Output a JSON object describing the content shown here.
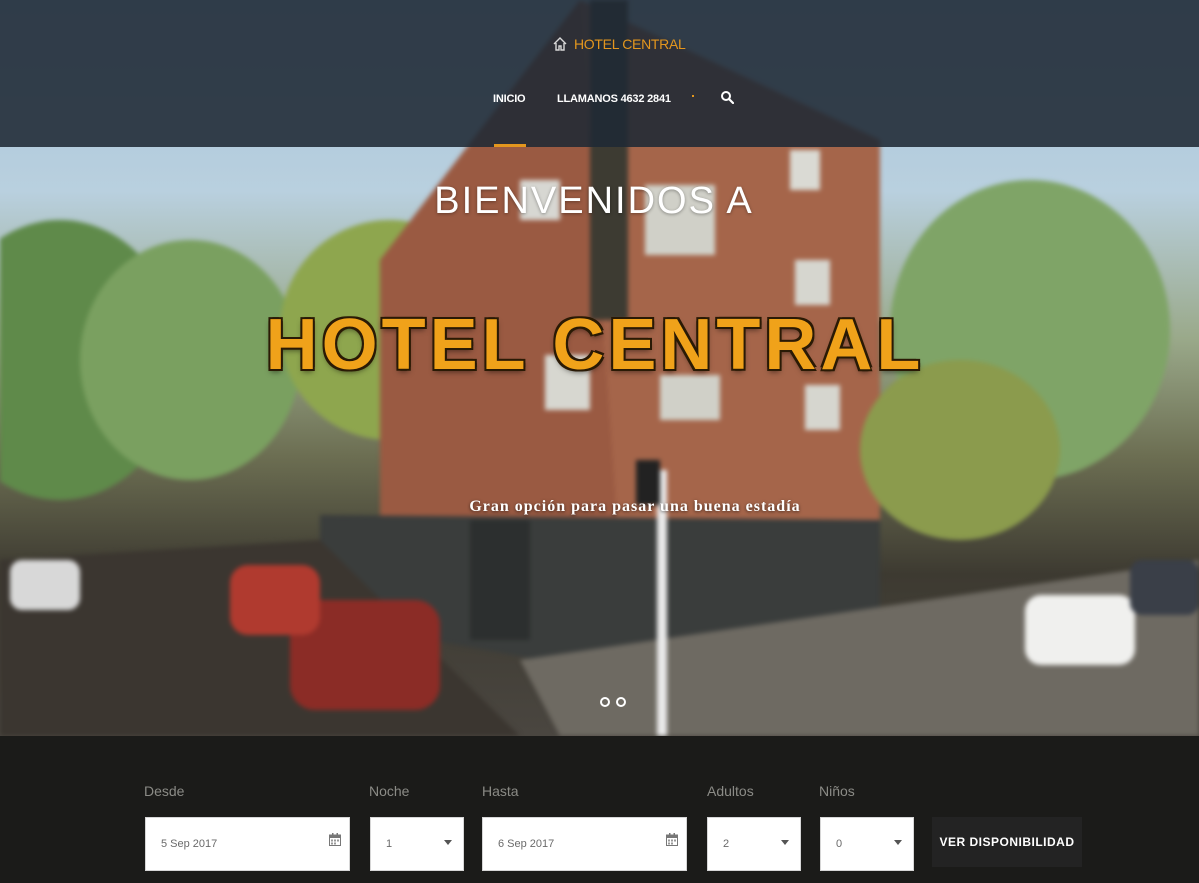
{
  "header": {
    "logo_text": "HOTEL CENTRAL",
    "logo_icon": "home-icon",
    "nav": {
      "inicio": "INICIO",
      "llamanos": "LLAMANOS 4632 2841"
    },
    "search_icon": "search-icon"
  },
  "hero": {
    "welcome": "BIENVENIDOS A",
    "title": "HOTEL CENTRAL",
    "tagline": "Gran opción para pasar una buena estadía",
    "slides_count": 2
  },
  "booking": {
    "desde": {
      "label": "Desde",
      "value": "5 Sep 2017"
    },
    "noche": {
      "label": "Noche",
      "value": "1"
    },
    "hasta": {
      "label": "Hasta",
      "value": "6 Sep 2017"
    },
    "adultos": {
      "label": "Adultos",
      "value": "2"
    },
    "ninos": {
      "label": "Niños",
      "value": "0"
    },
    "submit_label": "VER DISPONIBILIDAD"
  },
  "colors": {
    "accent": "#e3961e",
    "header_bg": "#1f2934",
    "footer_bg": "#1b1b19"
  }
}
